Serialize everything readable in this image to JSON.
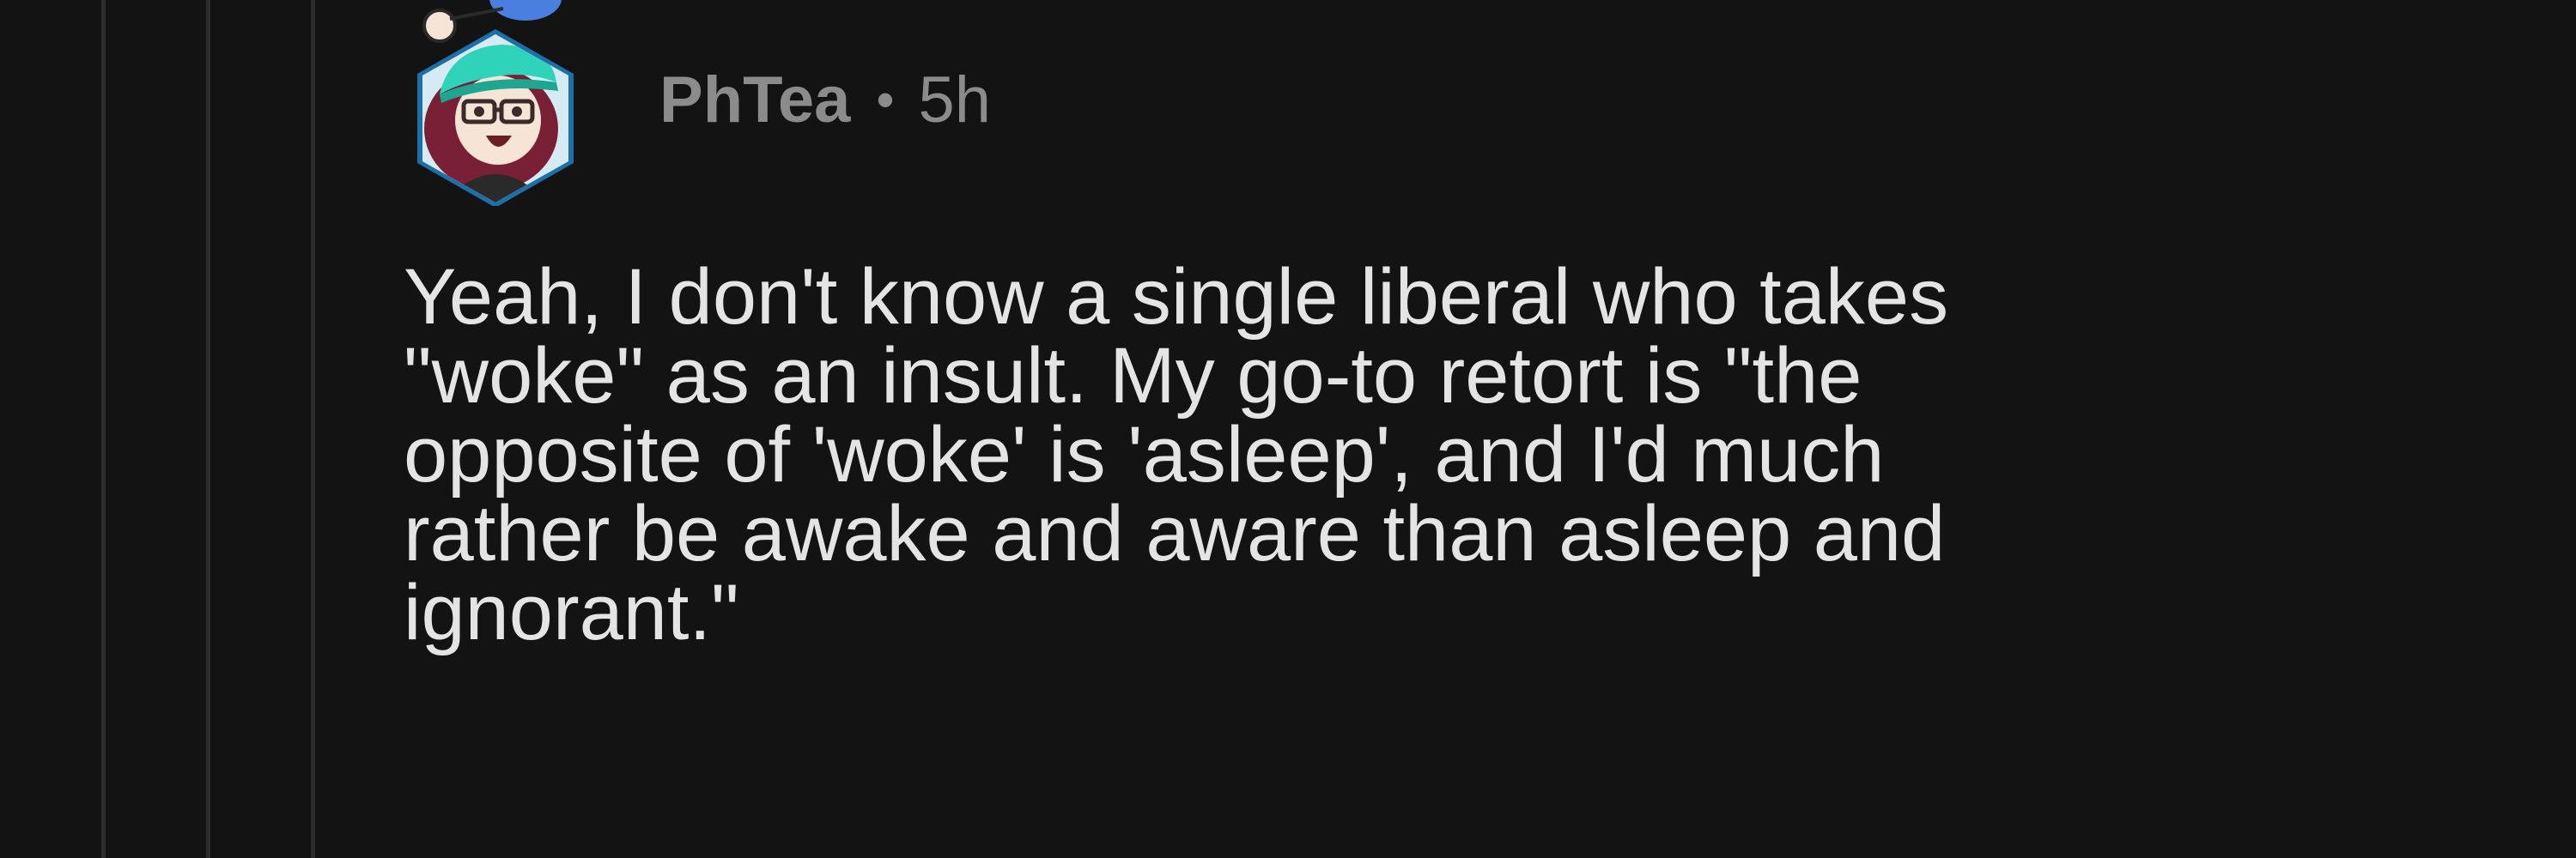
{
  "comment": {
    "username": "PhTea",
    "separator": "•",
    "age": "5h",
    "body_lines": [
      "Yeah, I don't know a single liberal who takes",
      "\"woke\" as an insult. My go-to retort is \"the",
      "opposite of 'woke' is 'asleep', and I'd much",
      "rather be awake and aware than asleep and",
      "ignorant.\""
    ]
  },
  "colors": {
    "background": "#131313",
    "thread_line": "#2c2c2c",
    "meta_text": "#8b8b8b",
    "body_text": "#e4e4e4",
    "avatar_frame": "#2f9fd8",
    "avatar_hat": "#2fd3b9"
  },
  "icons": {
    "avatar": "user-avatar-icon"
  }
}
